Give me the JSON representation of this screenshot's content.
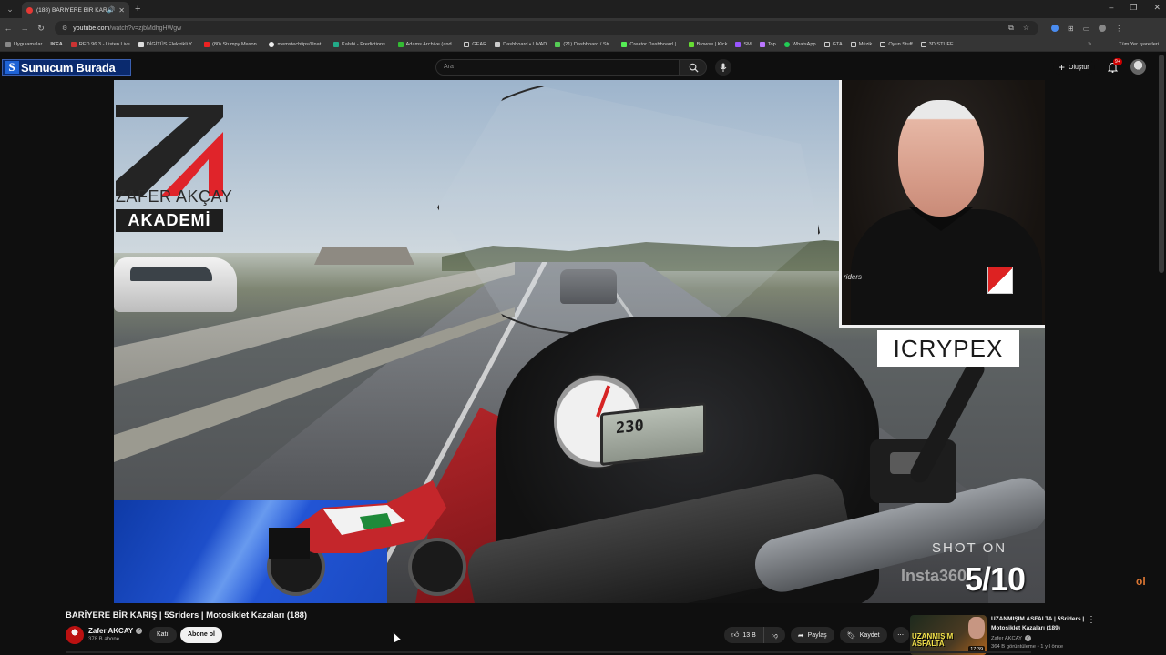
{
  "browser": {
    "tab_title": "(188) BARİYERE BİR KARIŞ | 5",
    "url_host": "youtube.com",
    "url_path": "/watch?v=zjbMdhgHWgw",
    "bookmarks": [
      "Uygulamalar",
      "IKEA",
      "RED 96.3 - Listen Live",
      "DİGİTÜS Elektrikli Y...",
      "(80) Stumpy Mason...",
      "memstechtips/Unat...",
      "Kalshi - Predictions...",
      "Adams Archive (and...",
      "GEAR",
      "Dashboard • LIVAD",
      "(21) Dashboard / Str...",
      "Creator Dashboard |...",
      "Browse | Kick",
      "SM",
      "Top",
      "WhatsApp",
      "GTA",
      "Müzik",
      "Oyun Stuff",
      "3D STUFF"
    ],
    "all_bookmarks": "Tüm Yer İşaretleri"
  },
  "youtube": {
    "logo_text": "Sunucum Burada",
    "search_placeholder": "Ara",
    "create_label": "Oluştur",
    "notif_badge": "9+"
  },
  "video": {
    "brand_name": "ZAFER AKÇAY",
    "brand_sub": "AKADEMİ",
    "sponsor": "ICRYPEX",
    "shot_on": "SHOT ON",
    "insta": "Insta360",
    "counter": "5/10",
    "speed": "230",
    "shirt_text": "riders"
  },
  "below": {
    "title": "BARİYERE BİR KARIŞ | 5Sriders | Motosiklet Kazaları (188)",
    "channel": "Zafer AKCAY",
    "subs": "378 B abone",
    "join": "Katıl",
    "subscribe": "Abone ol",
    "likes": "13 B",
    "share": "Paylaş",
    "save": "Kaydet"
  },
  "recommended": {
    "title": "UZANMIŞIM ASFALTA | 5Sriders | Motosiklet Kazaları (189)",
    "channel": "Zafer AKCAY",
    "meta": "364 B görüntüleme • 1 yıl önce",
    "duration": "17:39",
    "thumb_text": "UZANMIŞIM ASFALTA"
  }
}
